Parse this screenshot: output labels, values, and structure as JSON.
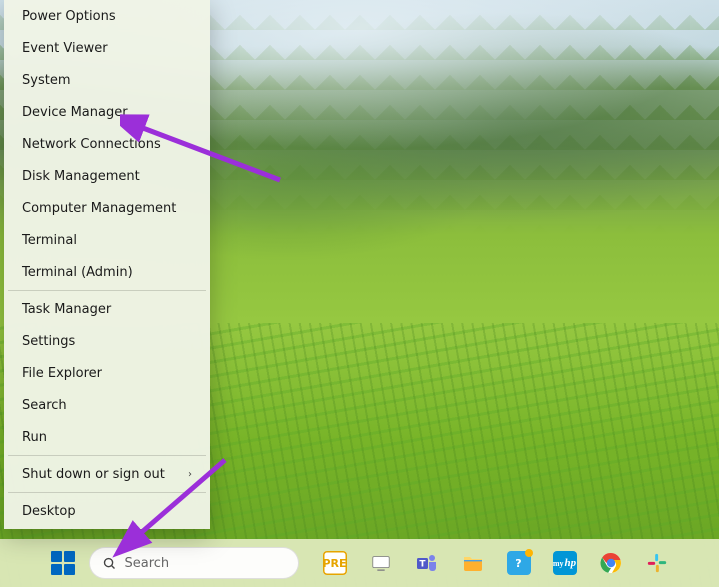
{
  "winx_menu": {
    "groups": [
      [
        "Power Options",
        "Event Viewer",
        "System",
        "Device Manager",
        "Network Connections",
        "Disk Management",
        "Computer Management",
        "Terminal",
        "Terminal (Admin)"
      ],
      [
        "Task Manager",
        "Settings",
        "File Explorer",
        "Search",
        "Run"
      ],
      [
        "Shut down or sign out"
      ],
      [
        "Desktop"
      ]
    ],
    "submenu_items": [
      "Shut down or sign out"
    ]
  },
  "search": {
    "placeholder": "Search"
  },
  "taskbar_apps": [
    {
      "name": "prerelease",
      "bg": "#ffffff",
      "label": "PRE",
      "fg": "#e6a400",
      "border": "#e6a400"
    },
    {
      "name": "task-view",
      "bg": "#2b2b2b",
      "label": "",
      "svg": "taskview"
    },
    {
      "name": "teams",
      "bg": "#ffffff",
      "label": "",
      "svg": "teams"
    },
    {
      "name": "file-explorer",
      "bg": "#ffffff",
      "label": "",
      "svg": "folder"
    },
    {
      "name": "help",
      "bg": "#2ea8e6",
      "label": "?",
      "badge": true
    },
    {
      "name": "myhp",
      "bg": "#0096d6",
      "label": "hp",
      "prefix": "my"
    },
    {
      "name": "chrome",
      "bg": "#ffffff",
      "label": "",
      "svg": "chrome"
    },
    {
      "name": "slack",
      "bg": "#ffffff",
      "label": "",
      "svg": "slack"
    }
  ],
  "annotations": {
    "arrow_color": "#9b2fd9"
  }
}
